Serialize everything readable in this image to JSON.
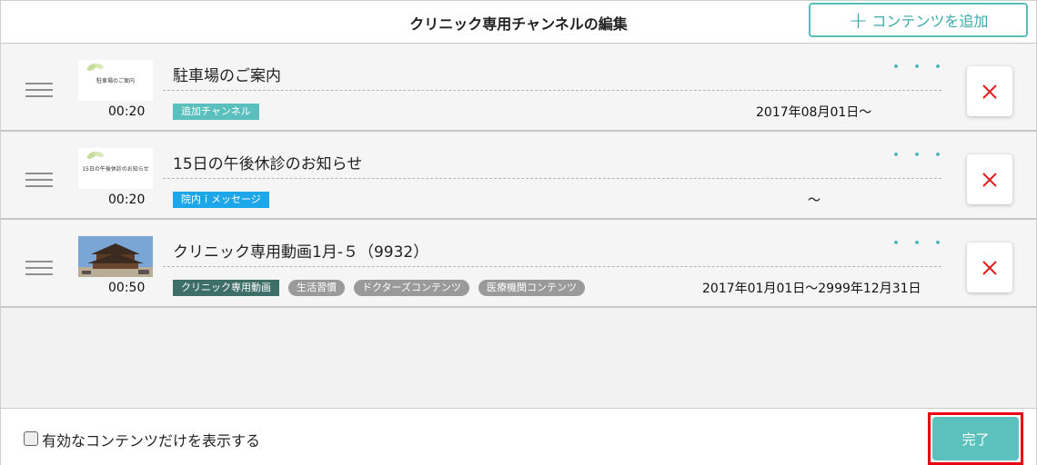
{
  "header": {
    "title": "クリニック専用チャンネルの編集",
    "add_button": {
      "icon": "plus-icon",
      "label": "コンテンツを追加"
    }
  },
  "rows": [
    {
      "title": "駐車場のご案内",
      "thumb_text": "駐車場のご案内",
      "duration": "00:20",
      "tags": [
        "追加チャンネル"
      ],
      "date": "2017年08月01日〜",
      "more": "・・・"
    },
    {
      "title": "15日の午後休診のお知らせ",
      "thumb_text": "15日の午後休診のお知らせ",
      "duration": "00:20",
      "tags": [
        "院内ｉメッセージ"
      ],
      "date": "〜",
      "more": "・・・"
    },
    {
      "title": "クリニック専用動画1月-５（9932）",
      "duration": "00:50",
      "tags": [
        "クリニック専用動画",
        "生活習慣",
        "ドクターズコンテンツ",
        "医療機関コンテンツ"
      ],
      "date": "2017年01月01日〜2999年12月31日",
      "more": "・・・"
    }
  ],
  "footer": {
    "filter_label": "有効なコンテンツだけを表示する",
    "done_label": "完了"
  },
  "colors": {
    "accent": "#5bbcbc",
    "tag_teal": "#5bc0bd",
    "tag_blue": "#1da7e8",
    "tag_dark": "#3d6e68",
    "tag_gray": "#9a9a9a",
    "delete_x": "#e02020",
    "highlight": "#e60012"
  }
}
